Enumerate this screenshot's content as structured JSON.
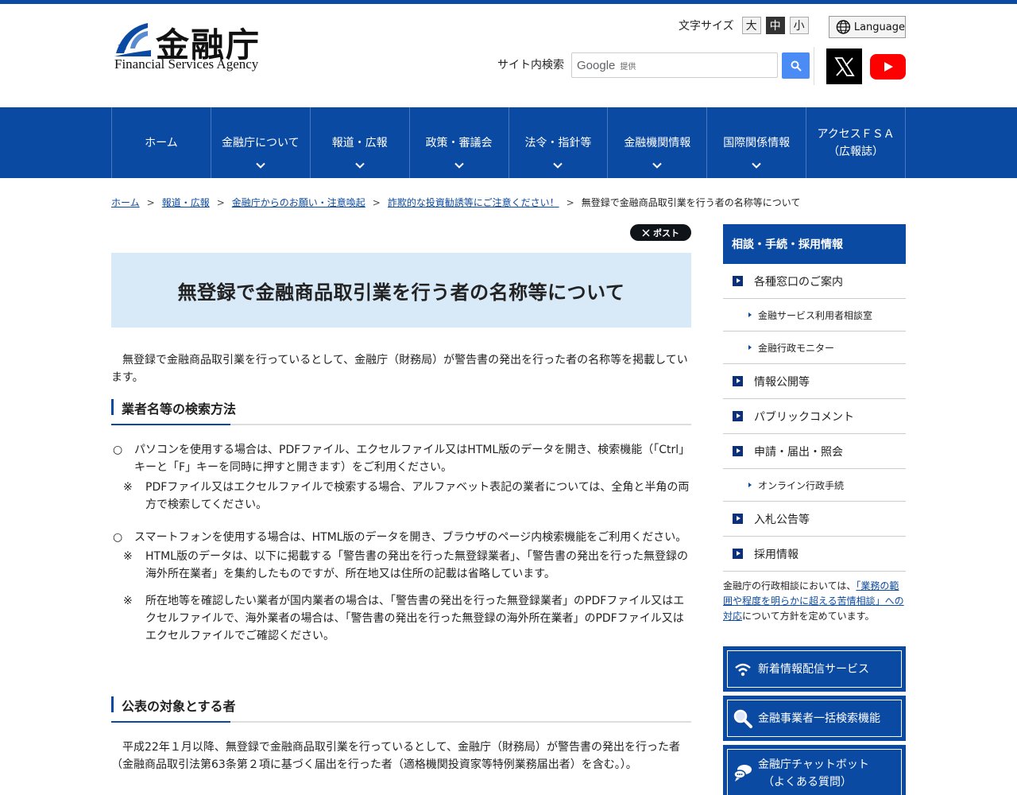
{
  "header": {
    "logo_jp": "金融庁",
    "logo_en": "Financial Services Agency",
    "font_size_label": "文字サイズ",
    "font_sizes": [
      "大",
      "中",
      "小"
    ],
    "font_size_active": "中",
    "language_label": "Language",
    "search_label": "サイト内検索",
    "search_google": "Google",
    "search_provided": "提供"
  },
  "nav": {
    "items": [
      {
        "label": "ホーム",
        "has_dropdown": false
      },
      {
        "label": "金融庁について",
        "has_dropdown": true
      },
      {
        "label": "報道・広報",
        "has_dropdown": true
      },
      {
        "label": "政策・審議会",
        "has_dropdown": true
      },
      {
        "label": "法令・指針等",
        "has_dropdown": true
      },
      {
        "label": "金融機関情報",
        "has_dropdown": true
      },
      {
        "label": "国際関係情報",
        "has_dropdown": true
      },
      {
        "label": "アクセスＦＳＡ",
        "label2": "（広報誌）",
        "has_dropdown": false
      }
    ]
  },
  "breadcrumb": {
    "items": [
      "ホーム",
      "報道・広報",
      "金融庁からのお願い・注意喚起",
      "詐欺的な投資勧誘等にご注意ください！"
    ],
    "current": "無登録で金融商品取引業を行う者の名称等について",
    "separator": ">"
  },
  "main": {
    "post_label": "ポスト",
    "title": "無登録で金融商品取引業を行う者の名称等について",
    "intro": "無登録で金融商品取引業を行っているとして、金融庁（財務局）が警告書の発出を行った者の名称等を掲載しています。",
    "section1": {
      "heading": "業者名等の検索方法",
      "para1_mark": "○",
      "para1": "パソコンを使用する場合は、PDFファイル、エクセルファイル又はHTML版のデータを開き、検索機能（「Ctrl」キーと「F」キーを同時に押すと開きます）をご利用ください。",
      "note1_mark": "※",
      "note1": "PDFファイル又はエクセルファイルで検索する場合、アルファベット表記の業者については、全角と半角の両方で検索してください。",
      "para2_mark": "○",
      "para2": "スマートフォンを使用する場合は、HTML版のデータを開き、ブラウザのページ内検索機能をご利用ください。",
      "note2_mark": "※",
      "note2": "HTML版のデータは、以下に掲載する「警告書の発出を行った無登録業者」、「警告書の発出を行った無登録の海外所在業者」を集約したものですが、所在地又は住所の記載は省略しています。",
      "note3_mark": "※",
      "note3": "所在地等を確認したい業者が国内業者の場合は、「警告書の発出を行った無登録業者」のPDFファイル又はエクセルファイルで、海外業者の場合は、「警告書の発出を行った無登録の海外所在業者」のPDFファイル又はエクセルファイルでご確認ください。"
    },
    "section2": {
      "heading": "公表の対象とする者",
      "para": "平成22年１月以降、無登録で金融商品取引業を行っているとして、金融庁（財務局）が警告書の発出を行った者（金融商品取引法第63条第２項に基づく届出を行った者（適格機関投資家等特例業務届出者）を含む。）。"
    }
  },
  "sidebar": {
    "heading": "相談・手続・採用情報",
    "items": [
      {
        "label": "各種窓口のご案内",
        "type": "main"
      },
      {
        "label": "金融サービス利用者相談室",
        "type": "sub"
      },
      {
        "label": "金融行政モニター",
        "type": "sub"
      },
      {
        "label": "情報公開等",
        "type": "main"
      },
      {
        "label": "パブリックコメント",
        "type": "main"
      },
      {
        "label": "申請・届出・照会",
        "type": "main"
      },
      {
        "label": "オンライン行政手続",
        "type": "sub"
      },
      {
        "label": "入札公告等",
        "type": "main"
      },
      {
        "label": "採用情報",
        "type": "main"
      }
    ],
    "note_before": "金融庁の行政相談においては、",
    "note_link": "「業務の範囲や程度を明らかに超える苦情相談」への対応",
    "note_after": "について方針を定めています。",
    "buttons": [
      {
        "label": "新着情報配信サービス",
        "icon": "wifi-icon"
      },
      {
        "label": "金融事業者一括検索機能",
        "icon": "search-icon"
      },
      {
        "label": "金融庁チャットボット",
        "label2": "（よくある質問）",
        "icon": "chat-icon"
      }
    ]
  },
  "colors": {
    "brand_blue": "#0b4aa2",
    "title_bg": "#d8e9f7"
  }
}
